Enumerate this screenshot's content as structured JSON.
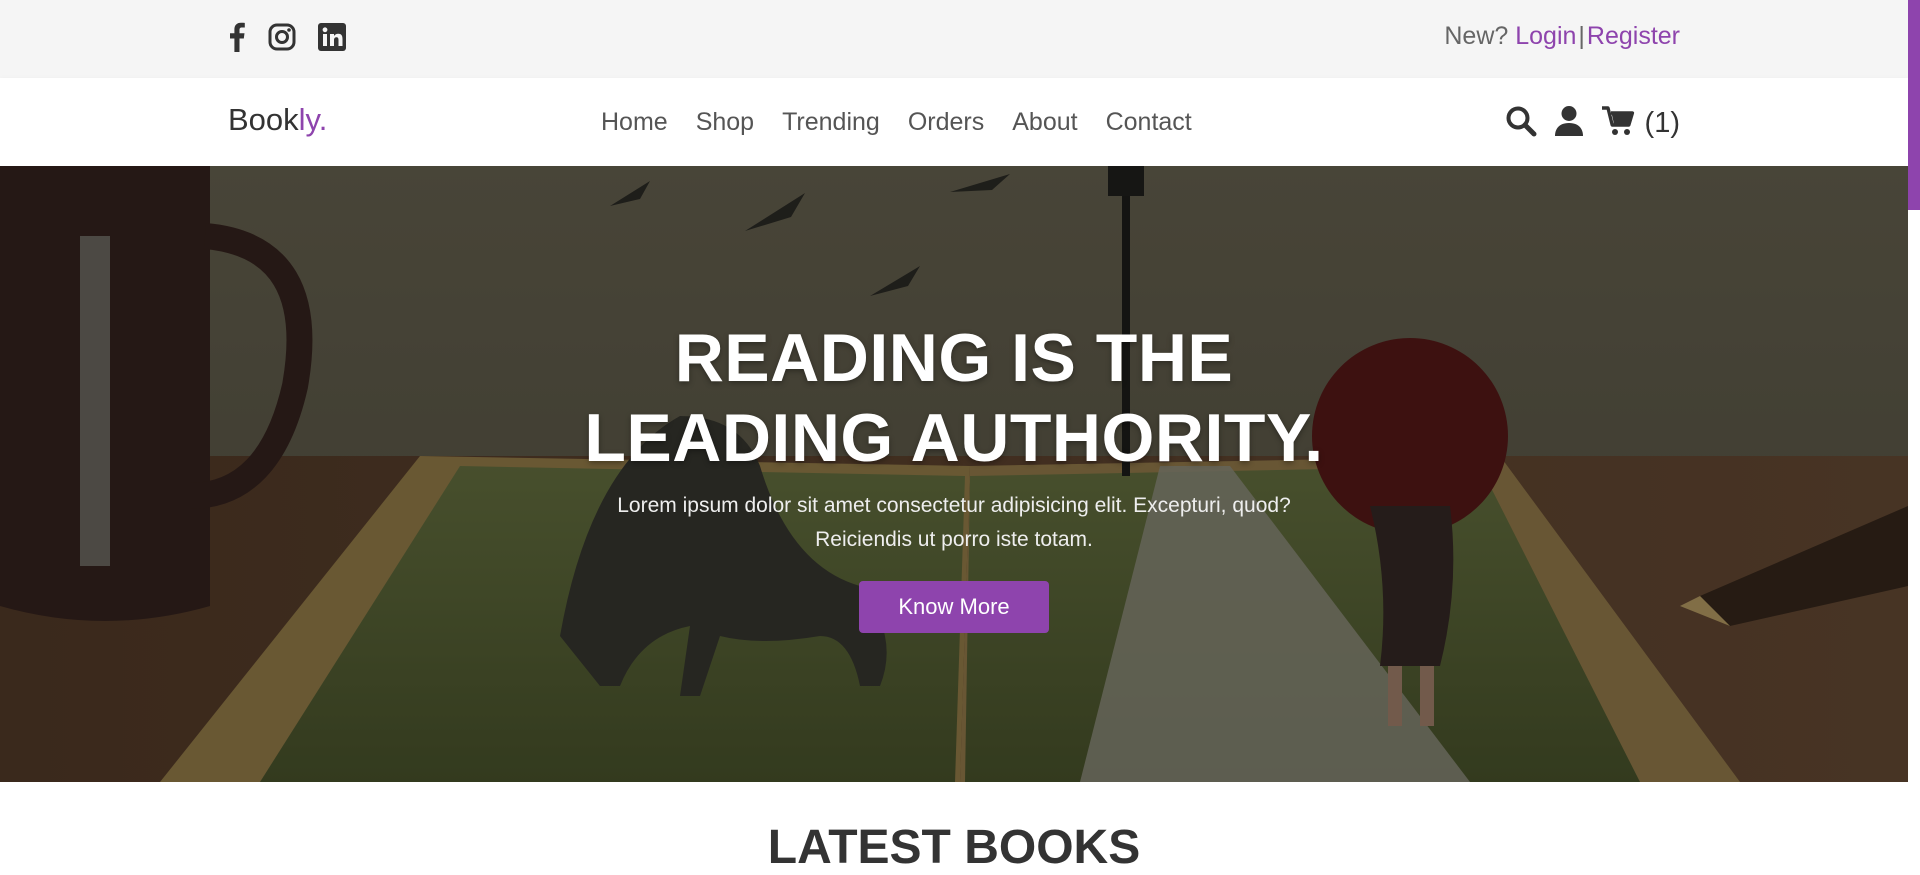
{
  "colors": {
    "accent": "#8e44ad",
    "topbar_bg": "#f5f5f5",
    "text_dark": "#333333"
  },
  "topbar": {
    "social_icons": [
      "facebook-icon",
      "instagram-icon",
      "linkedin-icon"
    ],
    "prefix": "New?",
    "login": "Login",
    "separator": "|",
    "register": "Register"
  },
  "navbar": {
    "logo_main": "Book",
    "logo_accent": "ly.",
    "links": [
      "Home",
      "Shop",
      "Trending",
      "Orders",
      "About",
      "Contact"
    ],
    "icons": [
      "search-icon",
      "user-icon",
      "cart-icon"
    ],
    "cart_count": "(1)"
  },
  "hero": {
    "title_line1": "READING IS THE",
    "title_line2": "LEADING AUTHORITY.",
    "text": "Lorem ipsum dolor sit amet consectetur adipisicing elit. Excepturi, quod? Reiciendis ut porro iste totam.",
    "button": "Know More"
  },
  "section": {
    "title": "LATEST BOOKS"
  }
}
